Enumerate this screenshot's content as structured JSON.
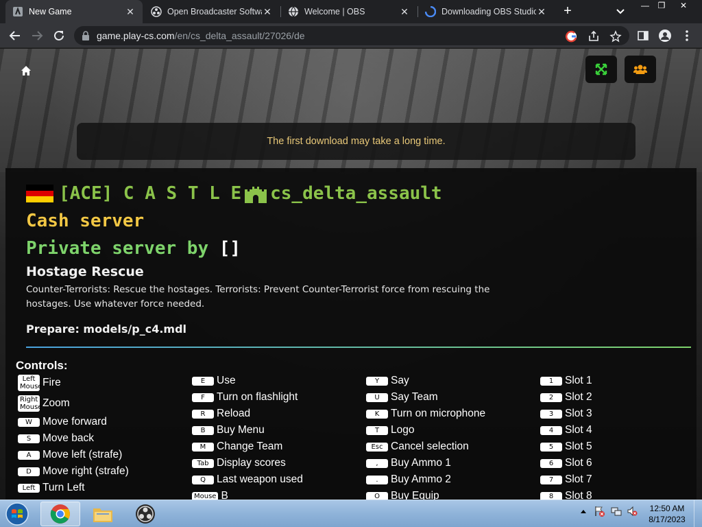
{
  "browser": {
    "tabs": [
      {
        "title": "New Game",
        "icon": "play-cs-icon"
      },
      {
        "title": "Open Broadcaster Software",
        "icon": "obs-icon"
      },
      {
        "title": "Welcome | OBS",
        "icon": "globe-icon"
      },
      {
        "title": "Downloading OBS Studio",
        "icon": "obs-loading-icon"
      }
    ],
    "url_host": "game.play-cs.com",
    "url_path": "/en/cs_delta_assault/27026/de"
  },
  "page": {
    "notice": "The first download may take a long time.",
    "server": {
      "name_prefix": "[ACE] C A S T L E",
      "map": "cs_delta_assault",
      "cash": "Cash server",
      "private_label": "Private server by",
      "private_owner": "[]",
      "mode": "Hostage Rescue",
      "description": "Counter-Terrorists: Rescue the hostages. Terrorists: Prevent Counter-Terrorist force from rescuing the hostages. Use whatever force needed.",
      "prepare": "Prepare: models/p_c4.mdl"
    },
    "controls_title": "Controls:",
    "controls": [
      [
        {
          "key": "Left Mouse",
          "action": "Fire"
        },
        {
          "key": "Right Mouse",
          "action": "Zoom"
        },
        {
          "key": "W",
          "action": "Move forward"
        },
        {
          "key": "S",
          "action": "Move back"
        },
        {
          "key": "A",
          "action": "Move left (strafe)"
        },
        {
          "key": "D",
          "action": "Move right (strafe)"
        },
        {
          "key": "Left",
          "action": "Turn Left"
        }
      ],
      [
        {
          "key": "E",
          "action": "Use"
        },
        {
          "key": "F",
          "action": "Turn on flashlight"
        },
        {
          "key": "R",
          "action": "Reload"
        },
        {
          "key": "B",
          "action": "Buy Menu"
        },
        {
          "key": "M",
          "action": "Change Team"
        },
        {
          "key": "Tab",
          "action": "Display scores"
        },
        {
          "key": "Q",
          "action": "Last weapon used"
        },
        {
          "key": "Mouse",
          "action": "B"
        }
      ],
      [
        {
          "key": "Y",
          "action": "Say"
        },
        {
          "key": "U",
          "action": "Say Team"
        },
        {
          "key": "K",
          "action": "Turn on microphone"
        },
        {
          "key": "T",
          "action": "Logo"
        },
        {
          "key": "Esc",
          "action": "Cancel selection"
        },
        {
          "key": ",",
          "action": "Buy Ammo 1"
        },
        {
          "key": ".",
          "action": "Buy Ammo 2"
        },
        {
          "key": "O",
          "action": "Buy Equip"
        }
      ],
      [
        {
          "key": "1",
          "action": "Slot 1"
        },
        {
          "key": "2",
          "action": "Slot 2"
        },
        {
          "key": "3",
          "action": "Slot 3"
        },
        {
          "key": "4",
          "action": "Slot 4"
        },
        {
          "key": "5",
          "action": "Slot 5"
        },
        {
          "key": "6",
          "action": "Slot 6"
        },
        {
          "key": "7",
          "action": "Slot 7"
        },
        {
          "key": "8",
          "action": "Slot 8"
        }
      ]
    ]
  },
  "taskbar": {
    "apps": [
      "chrome-icon",
      "explorer-icon",
      "obs-icon"
    ],
    "time": "12:50 AM",
    "date": "8/17/2023"
  },
  "colors": {
    "server_name": "#8bc34a",
    "cash": "#f2c744",
    "private": "#7ed36b",
    "notice": "#e8c878",
    "fullscreen_icon": "#3ad13a",
    "users_icon": "#f39c12"
  }
}
